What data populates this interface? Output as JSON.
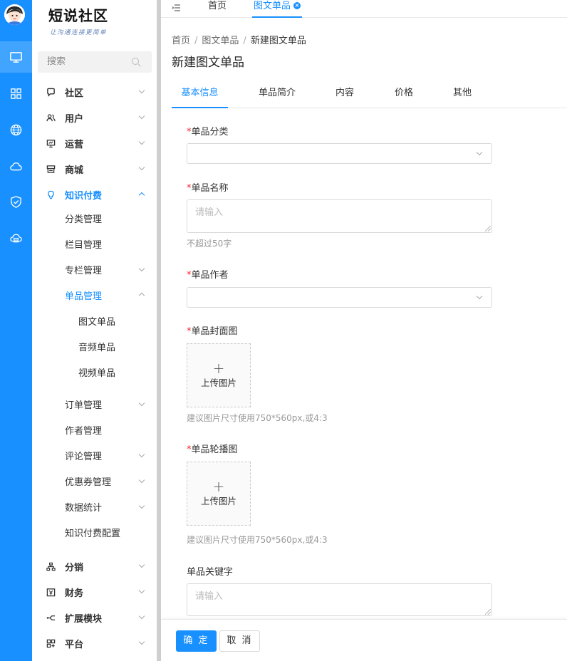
{
  "logo": {
    "title": "短说社区",
    "slogan": "让沟通连接更简单"
  },
  "search": {
    "placeholder": "搜索"
  },
  "menu": {
    "community": "社区",
    "users": "用户",
    "operations": "运营",
    "mall": "商城",
    "knowledge": "知识付费",
    "category_mgmt": "分类管理",
    "column_mgmt": "栏目管理",
    "special_mgmt": "专栏管理",
    "single_mgmt": "单品管理",
    "single_text": "图文单品",
    "single_audio": "音频单品",
    "single_video": "视频单品",
    "order_mgmt": "订单管理",
    "author_mgmt": "作者管理",
    "comment_mgmt": "评论管理",
    "coupon_mgmt": "优惠券管理",
    "stats": "数据统计",
    "knowledge_config": "知识付费配置",
    "distribution": "分销",
    "finance": "财务",
    "extensions": "扩展模块",
    "platform": "平台"
  },
  "tabs": {
    "home": "首页",
    "current": "图文单品"
  },
  "breadcrumb": {
    "home": "首页",
    "parent": "图文单品",
    "current": "新建图文单品",
    "sep": "/"
  },
  "page": {
    "title": "新建图文单品"
  },
  "subtabs": [
    "基本信息",
    "单品简介",
    "内容",
    "价格",
    "其他"
  ],
  "form": {
    "required_mark": "*",
    "category_label": "单品分类",
    "name_label": "单品名称",
    "name_placeholder": "请输入",
    "name_hint": "不超过50字",
    "author_label": "单品作者",
    "cover_label": "单品封面图",
    "upload_plus": "+",
    "upload_text": "上传图片",
    "cover_hint": "建议图片尺寸使用750*560px,或4:3",
    "carousel_label": "单品轮播图",
    "carousel_hint": "建议图片尺寸使用750*560px,或4:3",
    "keywords_label": "单品关键字",
    "keywords_placeholder": "请输入"
  },
  "buttons": {
    "confirm": "确 定",
    "cancel": "取 消"
  },
  "colors": {
    "primary": "#1890ff",
    "required": "#f5222d"
  }
}
